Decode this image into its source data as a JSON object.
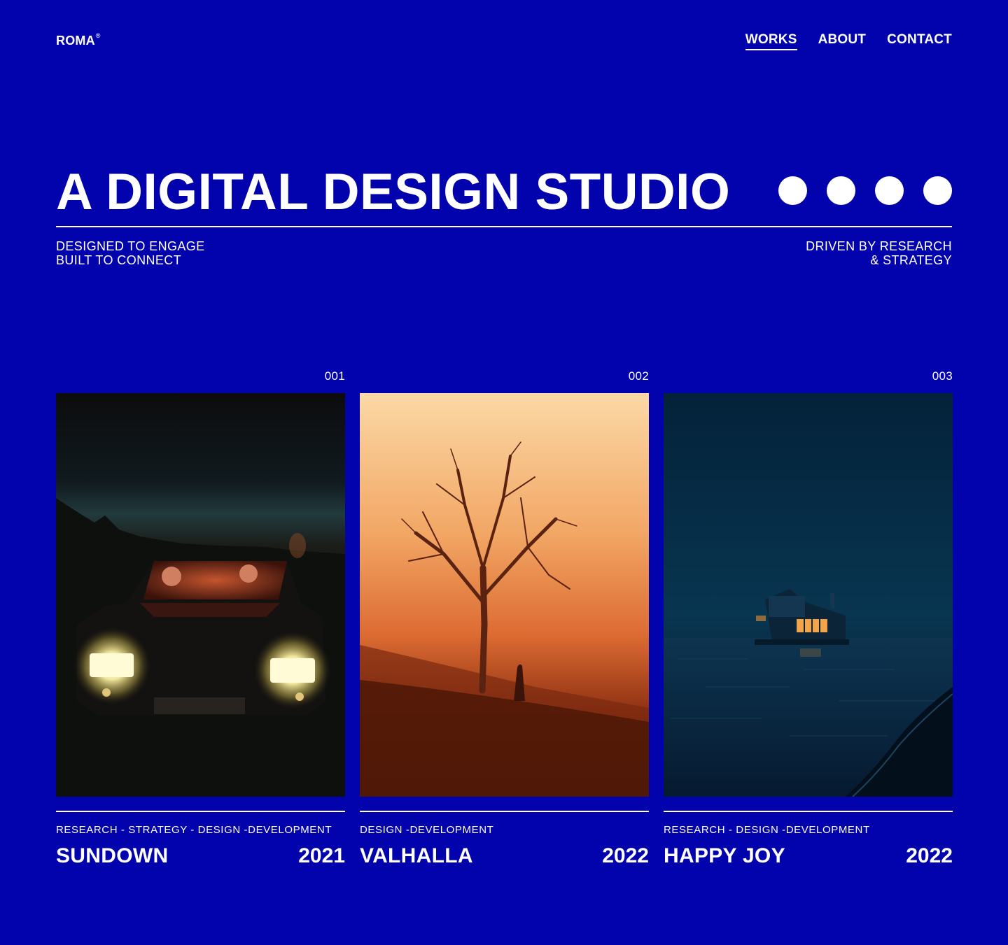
{
  "header": {
    "logo": "ROMA",
    "logo_mark": "®",
    "nav": [
      {
        "label": "WORKS",
        "active": true
      },
      {
        "label": "ABOUT",
        "active": false
      },
      {
        "label": "CONTACT",
        "active": false
      }
    ]
  },
  "hero": {
    "title": "A DIGITAL DESIGN STUDIO",
    "dot_count": 4,
    "tagline_left": [
      "DESIGNED TO ENGAGE",
      "BUILT TO CONNECT"
    ],
    "tagline_right": [
      "DRIVEN BY RESEARCH",
      "& STRATEGY"
    ]
  },
  "works": [
    {
      "number": "001",
      "tags": "RESEARCH - STRATEGY - DESIGN -DEVELOPMENT",
      "title": "SUNDOWN",
      "year": "2021",
      "image": "car-headlights-night"
    },
    {
      "number": "002",
      "tags": "DESIGN -DEVELOPMENT",
      "title": "VALHALLA",
      "year": "2022",
      "image": "foggy-tree-orange"
    },
    {
      "number": "003",
      "tags": "RESEARCH - DESIGN -DEVELOPMENT",
      "title": "HAPPY JOY",
      "year": "2022",
      "image": "house-on-water-night"
    }
  ],
  "colors": {
    "background": "#0303ad",
    "text": "#ffffff"
  }
}
